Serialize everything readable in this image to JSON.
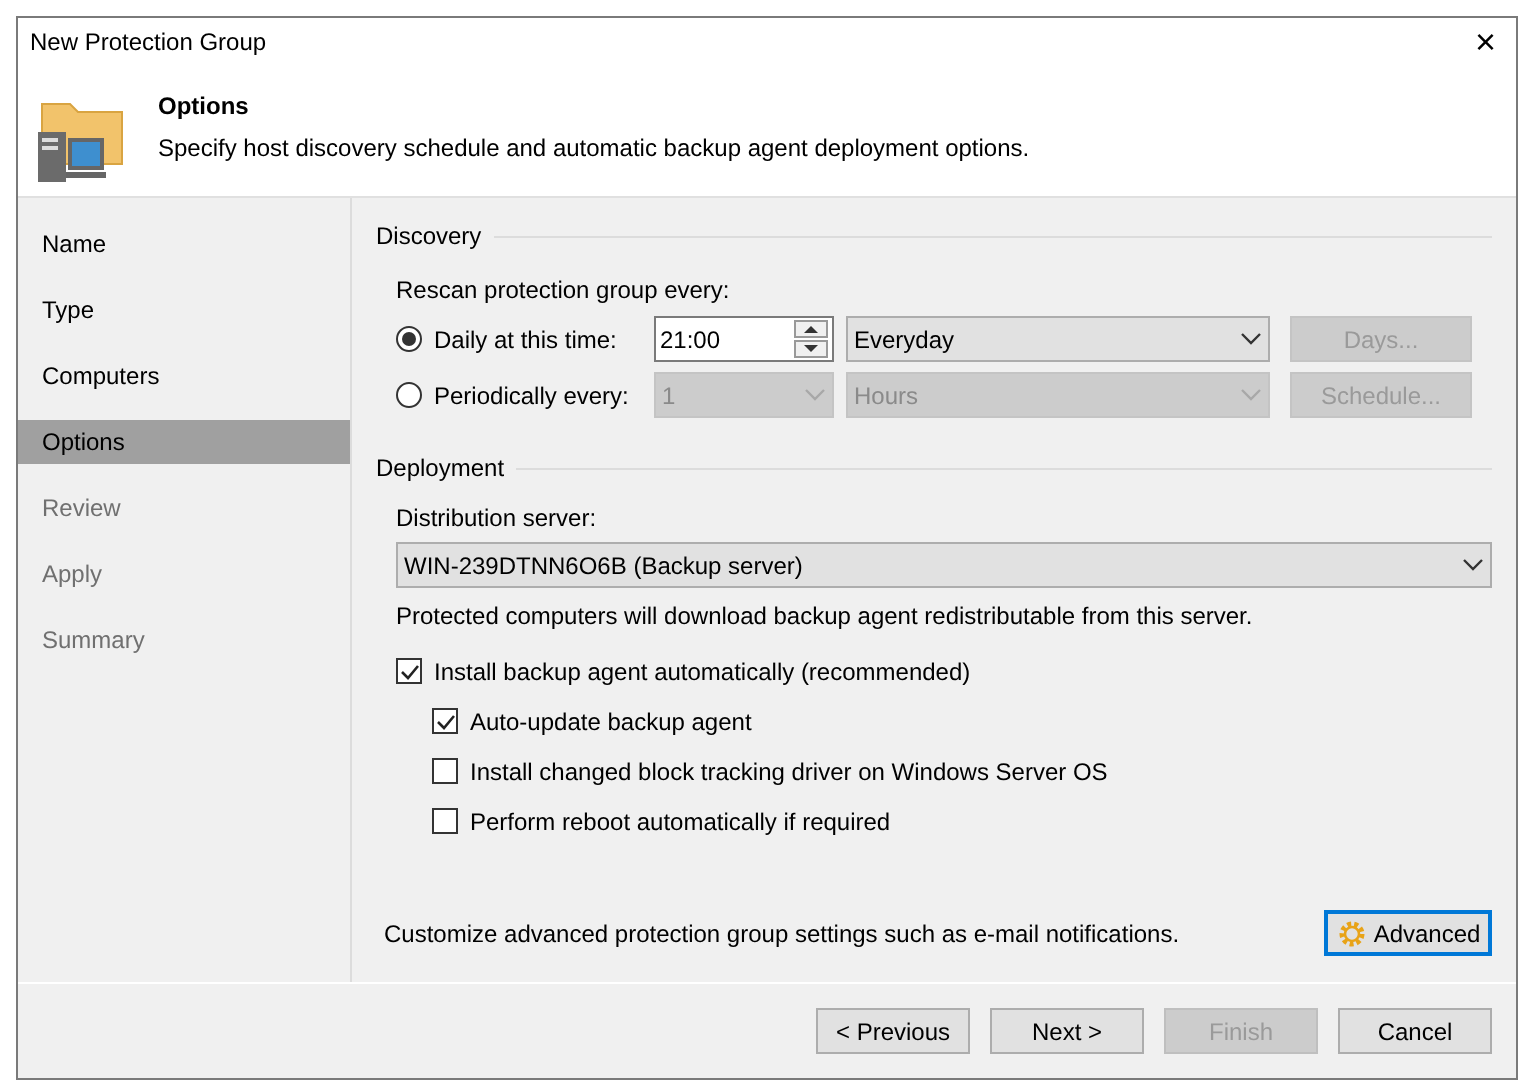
{
  "window": {
    "title": "New Protection Group",
    "close": "×"
  },
  "header": {
    "title": "Options",
    "description": "Specify host discovery schedule and automatic backup agent deployment options."
  },
  "steps": [
    {
      "label": "Name",
      "selected": false,
      "disabled": false
    },
    {
      "label": "Type",
      "selected": false,
      "disabled": false
    },
    {
      "label": "Computers",
      "selected": false,
      "disabled": false
    },
    {
      "label": "Options",
      "selected": true,
      "disabled": false
    },
    {
      "label": "Review",
      "selected": false,
      "disabled": true
    },
    {
      "label": "Apply",
      "selected": false,
      "disabled": true
    },
    {
      "label": "Summary",
      "selected": false,
      "disabled": true
    }
  ],
  "discovery": {
    "title": "Discovery",
    "label": "Rescan protection group every:",
    "rows": [
      {
        "label": "Daily at this time:",
        "selected": true,
        "fields": [
          {
            "kind": "spinner",
            "value": "21:00",
            "disabled": false
          },
          {
            "kind": "dropdown",
            "value": "Everyday",
            "disabled": false
          }
        ],
        "button": {
          "label": "Days...",
          "disabled": true
        }
      },
      {
        "label": "Periodically every:",
        "selected": false,
        "fields": [
          {
            "kind": "dropdown",
            "value": "1",
            "disabled": true
          },
          {
            "kind": "dropdown",
            "value": "Hours",
            "disabled": true
          }
        ],
        "button": {
          "label": "Schedule...",
          "disabled": true
        }
      }
    ]
  },
  "deployment": {
    "title": "Deployment",
    "server_label": "Distribution server:",
    "server": "WIN-239DTNN6O6B (Backup server)",
    "note": "Protected computers will download backup agent redistributable from this server.",
    "options": [
      {
        "label": "Install backup agent automatically (recommended)",
        "checked": true,
        "children": [
          {
            "label": "Auto-update backup agent",
            "checked": true
          },
          {
            "label": "Install changed block tracking driver on Windows Server OS",
            "checked": false
          },
          {
            "label": "Perform reboot automatically if required",
            "checked": false
          }
        ]
      }
    ]
  },
  "advanced": {
    "description": "Customize advanced protection group settings such as e-mail notifications.",
    "button": "Advanced"
  },
  "buttons": [
    {
      "label": "< Previous",
      "disabled": false
    },
    {
      "label": "Next >",
      "disabled": false
    },
    {
      "label": "Finish",
      "disabled": true
    },
    {
      "label": "Cancel",
      "disabled": false
    }
  ]
}
